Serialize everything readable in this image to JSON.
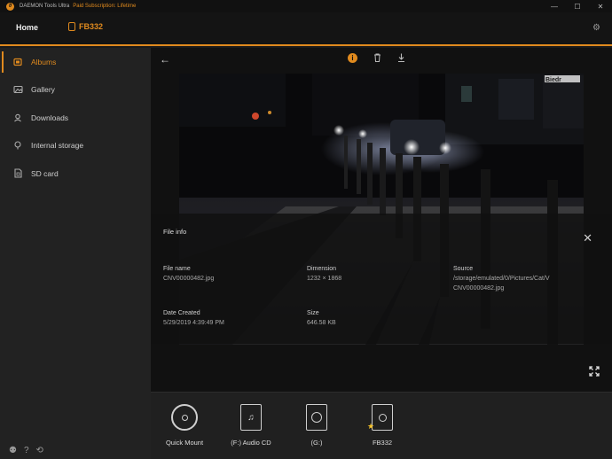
{
  "titlebar": {
    "app_name": "DAEMON Tools Ultra",
    "subscription": "Paid Subscription: Lifetime",
    "controls": [
      "—",
      "☐",
      "✕"
    ]
  },
  "header": {
    "home_label": "Home",
    "device_label": "FB332"
  },
  "sidebar": {
    "items": [
      {
        "label": "Albums",
        "icon": "album-icon",
        "active": true
      },
      {
        "label": "Gallery",
        "icon": "gallery-icon",
        "active": false
      },
      {
        "label": "Downloads",
        "icon": "downloads-icon",
        "active": false
      },
      {
        "label": "Internal storage",
        "icon": "internal-storage-icon",
        "active": false
      },
      {
        "label": "SD card",
        "icon": "sd-card-icon",
        "active": false
      }
    ]
  },
  "viewer": {
    "info": {
      "title": "File info",
      "file_name_label": "File name",
      "file_name_value": "CNV00000482.jpg",
      "dimension_label": "Dimension",
      "dimension_value": "1232 × 1868",
      "source_label": "Source",
      "source_value_1": "/storage/emulated/0/Pictures/Cat/V",
      "source_value_2": "CNV00000482.jpg",
      "date_label": "Date Created",
      "date_value": "5/29/2019 4:39:49 PM",
      "size_label": "Size",
      "size_value": "646.58 KB"
    },
    "sign_text": "Biedr"
  },
  "dock": {
    "items": [
      {
        "label": "Quick Mount",
        "icon": "quick-mount-disc-icon"
      },
      {
        "label": "(F:) Audio CD",
        "icon": "audio-cd-icon"
      },
      {
        "label": "(G:)",
        "icon": "drive-g-icon"
      },
      {
        "label": "FB332",
        "icon": "phone-device-icon"
      }
    ]
  },
  "colors": {
    "accent": "#e08a1e",
    "background": "#1b1b1b"
  }
}
